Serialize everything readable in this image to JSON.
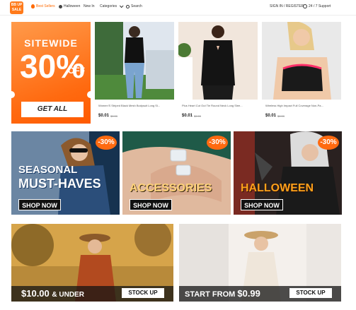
{
  "header": {
    "logo": "BB UP SALE",
    "nav": [
      "Best Sellers",
      "Halloween",
      "New In",
      "Categories"
    ],
    "search": "Search",
    "signin": "SIGN IN / REGISTER",
    "support": "24 / 7 Support"
  },
  "promo": {
    "line1": "SITEWIDE",
    "percent": "30%",
    "off": "OFF",
    "button": "GET ALL"
  },
  "products": [
    {
      "title": "Women'S Striped Black Mesh Bodysuit Long Sl...",
      "price": "$0.01",
      "orig": "$9.99"
    },
    {
      "title": "Plus Heart Cut Out Tie Round Neck Long Slee...",
      "price": "$0.01",
      "orig": "$9.99"
    },
    {
      "title": "Wireless High Impact Full Coverage Non-Pa...",
      "price": "$0.01",
      "orig": "$9.99"
    }
  ],
  "banners": [
    {
      "tag": "-30%",
      "line1": "SEASONAL",
      "line2": "MUST-HAVES",
      "button": "SHOP NOW"
    },
    {
      "tag": "-30%",
      "line1": "ACCESSORIES",
      "button": "SHOP NOW"
    },
    {
      "tag": "-30%",
      "line1": "HALLOWEEN",
      "button": "SHOP NOW"
    }
  ],
  "bottom": [
    {
      "price": "$10.00",
      "suffix": "& UNDER",
      "button": "STOCK UP"
    },
    {
      "prefix": "START FROM",
      "price": "$0.99",
      "button": "STOCK UP"
    }
  ],
  "colors": {
    "accent": "#ff6a10"
  }
}
